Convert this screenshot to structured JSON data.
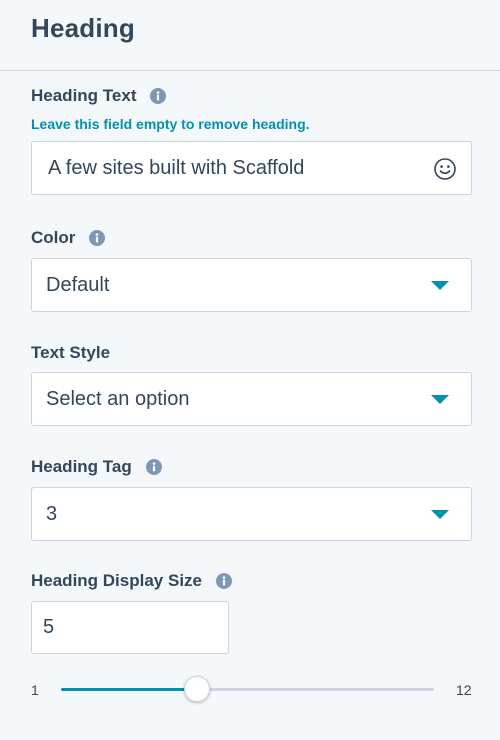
{
  "panel": {
    "title": "Heading"
  },
  "heading_text": {
    "label": "Heading Text",
    "help": "Leave this field empty to remove heading.",
    "value": "A few sites built with Scaffold"
  },
  "color": {
    "label": "Color",
    "selected": "Default"
  },
  "text_style": {
    "label": "Text Style",
    "selected": "Select an option"
  },
  "heading_tag": {
    "label": "Heading Tag",
    "selected": "3"
  },
  "display_size": {
    "label": "Heading Display Size",
    "value": "5",
    "slider_min": "1",
    "slider_max": "12",
    "slider_level": 5
  },
  "colors": {
    "accent": "#0091ae",
    "text": "#33475b",
    "border": "#cbd6e2",
    "background": "#f5f8fa",
    "info_icon": "#7c98b6"
  },
  "icons": {
    "info": "info-icon",
    "emoji": "emoji-picker-icon",
    "dropdown": "chevron-down-icon"
  }
}
